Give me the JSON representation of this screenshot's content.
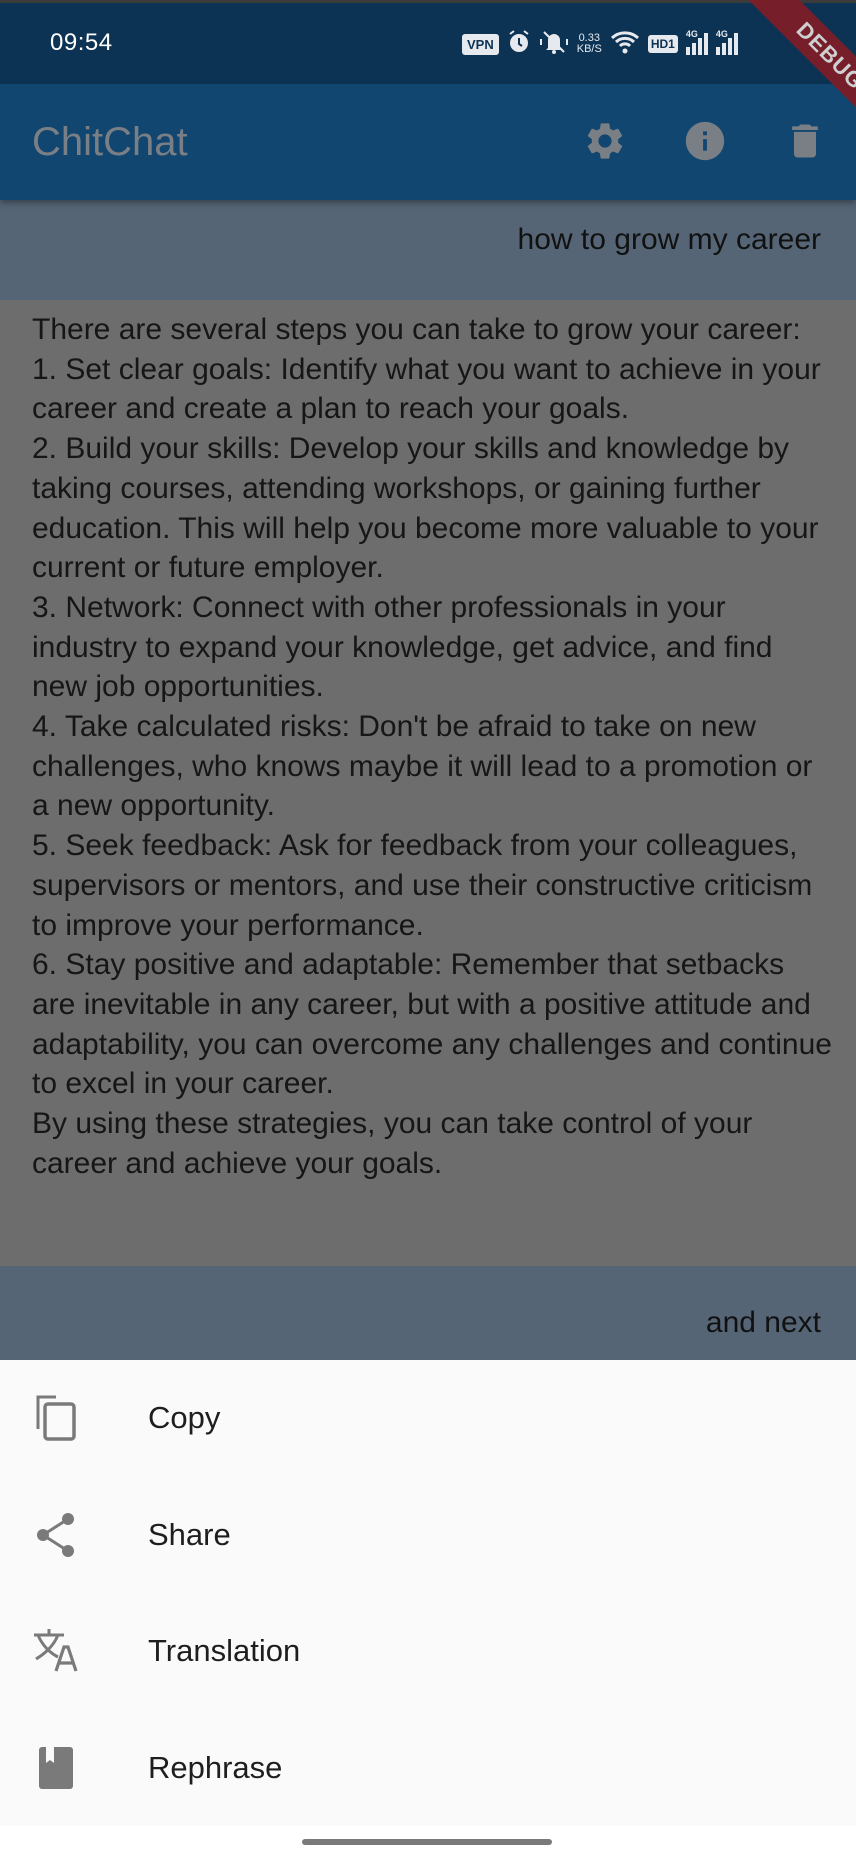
{
  "status_bar": {
    "time": "09:54",
    "vpn_label": "VPN",
    "net_rate_value": "0.33",
    "net_rate_unit": "KB/S",
    "hd_label": "HD1",
    "sim1_label": "4G",
    "sim2_label": "4G",
    "icons": [
      "vpn-icon",
      "alarm-icon",
      "vibrate-mute-icon",
      "wifi-icon",
      "hd-volte-icon",
      "signal-4g-icon",
      "signal-4g-icon"
    ]
  },
  "debug_banner": {
    "label": "DEBUG"
  },
  "app_bar": {
    "title": "ChitChat",
    "actions": [
      {
        "name": "settings",
        "icon": "gear-icon"
      },
      {
        "name": "info",
        "icon": "info-icon"
      },
      {
        "name": "delete",
        "icon": "trash-icon"
      }
    ]
  },
  "chat": {
    "messages": [
      {
        "role": "user",
        "text": "how to grow my career"
      },
      {
        "role": "assistant",
        "text": "There are several steps you can take to grow your career:\n1. Set clear goals: Identify what you want to achieve in your career and create a plan to reach your goals.\n2. Build your skills: Develop your skills and knowledge by taking courses, attending workshops, or gaining further education. This will help you become more valuable to your current or future employer.\n3. Network: Connect with other professionals in your industry to expand your knowledge, get advice, and find new job opportunities.\n4. Take calculated risks: Don't be afraid to take on new challenges, who knows maybe it will lead to a promotion or a new opportunity.\n5. Seek feedback: Ask for feedback from your colleagues, supervisors or mentors, and use their constructive criticism to improve your performance.\n6. Stay positive and adaptable: Remember that setbacks are inevitable in any career, but with a positive attitude and adaptability, you can overcome any challenges and continue to excel in your career.\nBy using these strategies, you can take control of your career and achieve your goals."
      },
      {
        "role": "user",
        "text": "and next"
      }
    ]
  },
  "bottom_sheet": {
    "items": [
      {
        "label": "Copy",
        "icon": "copy-icon"
      },
      {
        "label": "Share",
        "icon": "share-icon"
      },
      {
        "label": "Translation",
        "icon": "translate-icon"
      },
      {
        "label": "Rephrase",
        "icon": "book-icon"
      }
    ]
  },
  "colors": {
    "status_bar_bg": "#0d3354",
    "app_bar_bg": "#114670",
    "user_bubble_bg": "#556575",
    "assistant_bubble_bg": "#6d6d6d",
    "sheet_bg": "#fafafa",
    "icon_gray": "#7a7a7a",
    "debug_ribbon": "#7c1d27"
  }
}
